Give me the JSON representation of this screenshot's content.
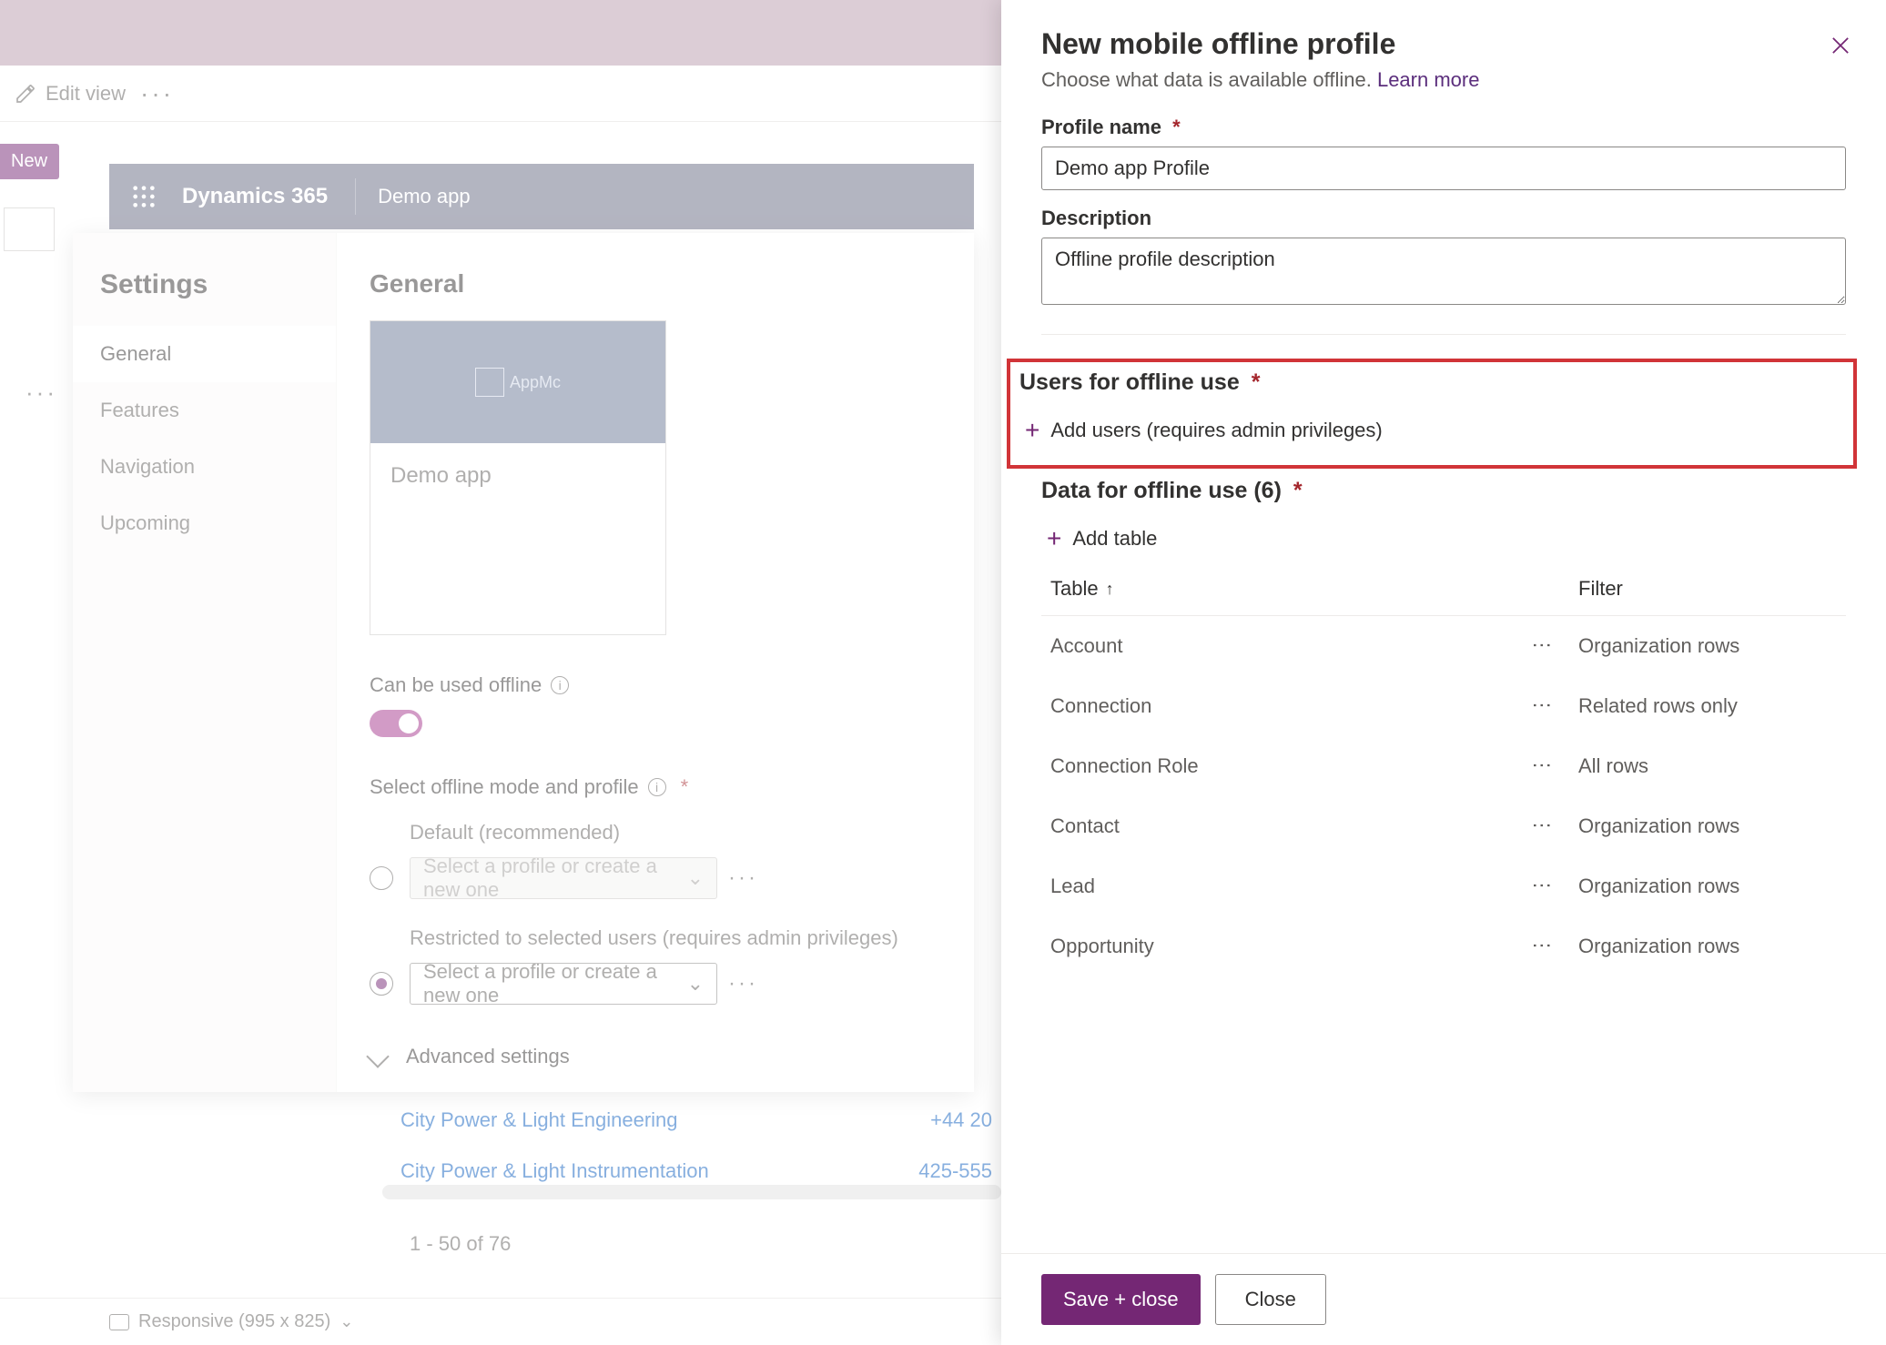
{
  "editBar": {
    "label": "Edit view"
  },
  "leftStrip": {
    "newLabel": "New"
  },
  "appHeader": {
    "brand": "Dynamics 365",
    "name": "Demo app"
  },
  "settings": {
    "title": "Settings",
    "nav": {
      "general": "General",
      "features": "Features",
      "navigation": "Navigation",
      "upcoming": "Upcoming"
    },
    "general": {
      "heading": "General",
      "tileImgAlt": "AppMc",
      "tileName": "Demo app",
      "offlineLabel": "Can be used offline",
      "selectModeLabel": "Select offline mode and profile",
      "defaultLabel": "Default (recommended)",
      "restrictedLabel": "Restricted to selected users (requires admin privileges)",
      "profilePlaceholder": "Select a profile or create a new one",
      "advanced": "Advanced settings"
    }
  },
  "bgRows": {
    "r1": {
      "name": "City Power & Light Engineering",
      "phone": "+44 20"
    },
    "r2": {
      "name": "City Power & Light Instrumentation",
      "phone": "425-555"
    },
    "pager": "1 - 50 of 76"
  },
  "statusbar": {
    "responsive": "Responsive (995 x 825)"
  },
  "panel": {
    "title": "New mobile offline profile",
    "subtitle": "Choose what data is available offline.",
    "learnMore": "Learn more",
    "profileNameLabel": "Profile name",
    "profileNameValue": "Demo app Profile",
    "descriptionLabel": "Description",
    "descriptionValue": "Offline profile description",
    "usersTitle": "Users for offline use",
    "addUsers": "Add users (requires admin privileges)",
    "dataTitle": "Data for offline use (6)",
    "addTable": "Add table",
    "tableHeader": "Table",
    "filterHeader": "Filter",
    "rows": [
      {
        "table": "Account",
        "filter": "Organization rows"
      },
      {
        "table": "Connection",
        "filter": "Related rows only"
      },
      {
        "table": "Connection Role",
        "filter": "All rows"
      },
      {
        "table": "Contact",
        "filter": "Organization rows"
      },
      {
        "table": "Lead",
        "filter": "Organization rows"
      },
      {
        "table": "Opportunity",
        "filter": "Organization rows"
      }
    ],
    "saveLabel": "Save + close",
    "closeLabel": "Close"
  }
}
